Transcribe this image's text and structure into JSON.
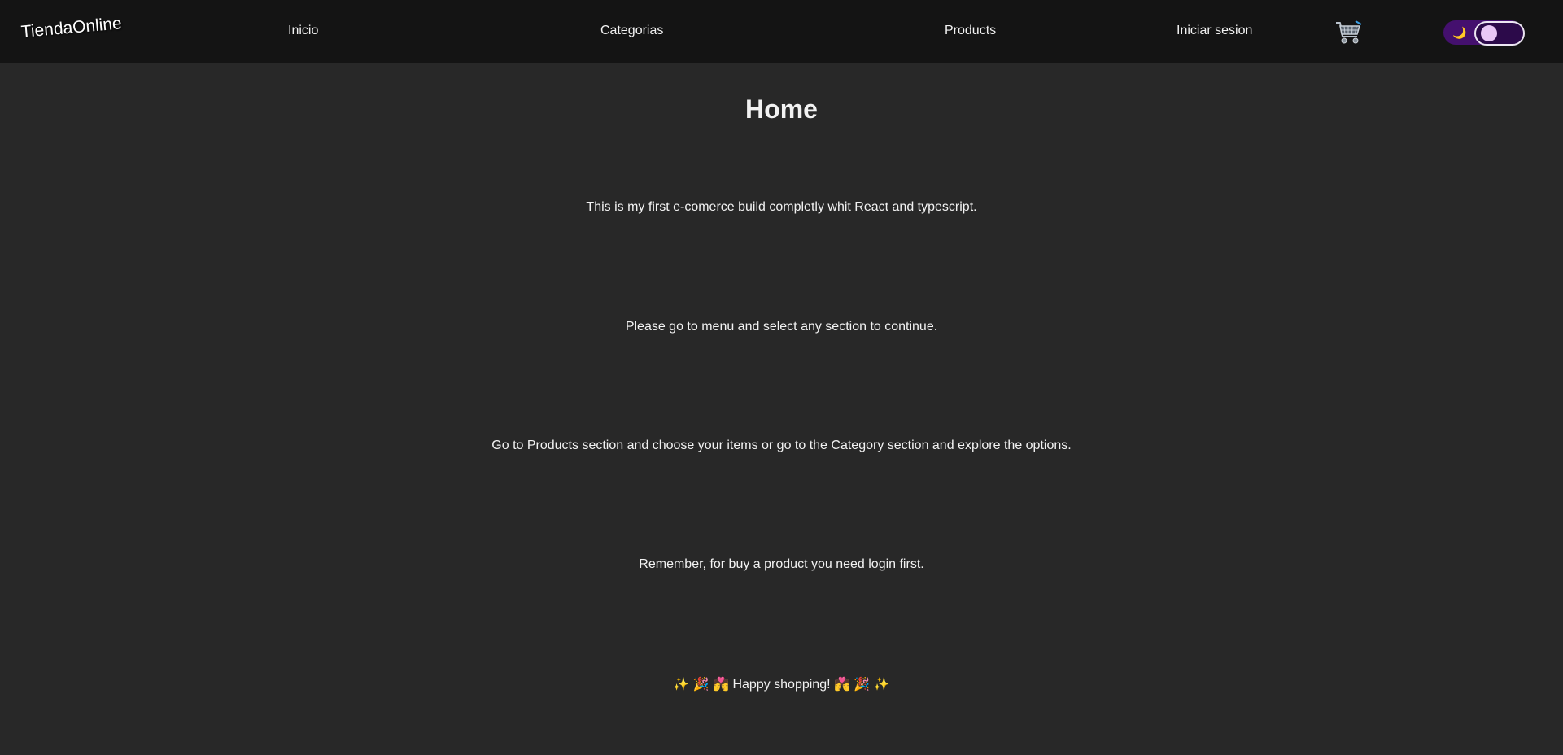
{
  "navbar": {
    "brand": "TiendaOnline",
    "links": {
      "inicio": "Inicio",
      "categorias": "Categorias",
      "products": "Products",
      "login": "Iniciar sesion"
    },
    "cart_icon": "shopping-cart-icon",
    "theme_toggle": {
      "icon": "moon-icon",
      "glyph": "🌙",
      "state": "dark",
      "accent": "#44106e",
      "knob_color": "#e8c7f5"
    },
    "border_color": "#5b2a86"
  },
  "main": {
    "title": "Home",
    "paragraphs": [
      "This is my first e-comerce build completly whit React and typescript.",
      "Please go to menu and select any section to continue.",
      "Go to Products section and choose your items or go to the Category section and explore the options.",
      "Remember, for buy a product you need login first.",
      "✨ 🎉 💏 Happy shopping! 💏 🎉 ✨"
    ]
  },
  "colors": {
    "background": "#282828",
    "navbar_background": "#141414",
    "text": "#f2f2f2"
  }
}
